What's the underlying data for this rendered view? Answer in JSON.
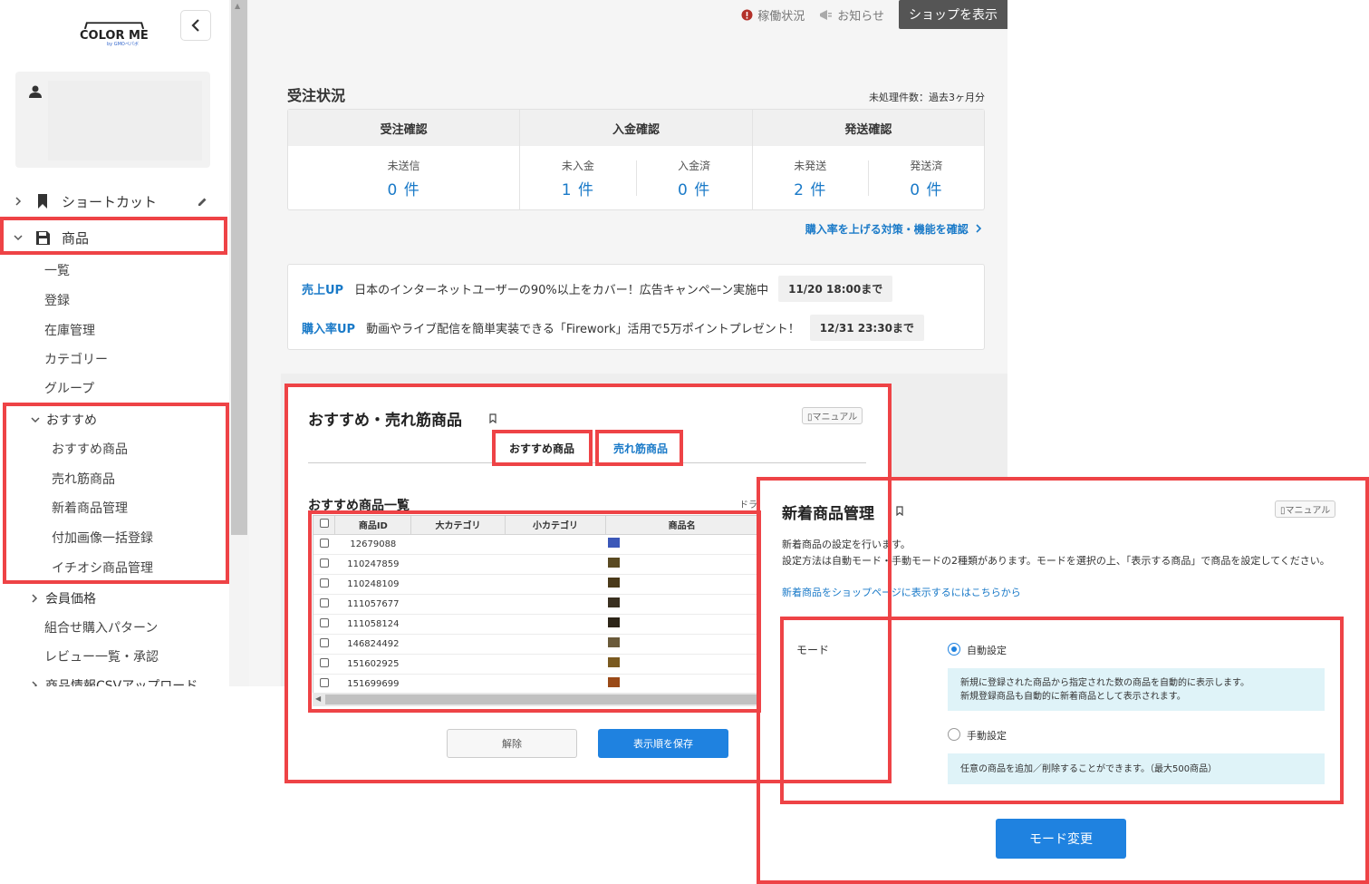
{
  "sidebar": {
    "logo_text": "COLOR ME",
    "logo_sub": "by GMOペパボ",
    "shortcut_label": "ショートカット",
    "products_label": "商品",
    "product_items": [
      "一覧",
      "登録",
      "在庫管理",
      "カテゴリー",
      "グループ"
    ],
    "recommend_label": "おすすめ",
    "recommend_items": [
      "おすすめ商品",
      "売れ筋商品",
      "新着商品管理",
      "付加画像一括登録",
      "イチオシ商品管理"
    ],
    "member_price_label": "会員価格",
    "more_items": [
      "組合せ購入パターン",
      "レビュー一覧・承認",
      "商品情報CSVアップロード"
    ]
  },
  "topbar": {
    "status_label": "稼働状況",
    "news_label": "お知らせ",
    "shop_button": "ショップを表示"
  },
  "orders": {
    "title": "受注状況",
    "note": "未処理件数：過去3ヶ月分",
    "headers": [
      "受注確認",
      "入金確認",
      "発送確認"
    ],
    "unsent_label": "未送信",
    "unsent_value": "0 件",
    "unpaid_label": "未入金",
    "unpaid_value": "1 件",
    "paid_label": "入金済",
    "paid_value": "0 件",
    "unshipped_label": "未発送",
    "unshipped_value": "2 件",
    "shipped_label": "発送済",
    "shipped_value": "0 件",
    "conversion_link": "購入率を上げる対策・機能を確認"
  },
  "promos": [
    {
      "tag": "売上UP",
      "text": "日本のインターネットユーザーの90%以上をカバー！広告キャンペーン実施中",
      "deadline": "11/20 18:00まで"
    },
    {
      "tag": "購入率UP",
      "text": "動画やライブ配信を簡単実装できる「Firework」活用で5万ポイントプレゼント！",
      "deadline": "12/31 23:30まで"
    }
  ],
  "recommend_panel": {
    "title": "おすすめ・売れ筋商品",
    "manual": "マニュアル",
    "tab_recommend": "おすすめ商品",
    "tab_bestseller": "売れ筋商品",
    "list_title": "おすすめ商品一覧",
    "drag_hint": "ドラ",
    "columns": [
      "商品ID",
      "大カテゴリ",
      "小カテゴリ",
      "商品名"
    ],
    "rows": [
      "12679088",
      "110247859",
      "110248109",
      "111057677",
      "111058124",
      "146824492",
      "151602925",
      "151699699"
    ],
    "release_button": "解除",
    "save_button": "表示順を保存"
  },
  "new_panel": {
    "title": "新着商品管理",
    "manual": "マニュアル",
    "desc1": "新着商品の設定を行います。",
    "desc2": "設定方法は自動モード・手動モードの2種類があります。モードを選択の上、「表示する商品」で商品を設定してください。",
    "link": "新着商品をショップページに表示するにはこちらから",
    "mode_label": "モード",
    "auto_label": "自動設定",
    "auto_info1": "新規に登録された商品から指定された数の商品を自動的に表示します。",
    "auto_info2": "新規登録商品も自動的に新着商品として表示されます。",
    "manual_label": "手動設定",
    "manual_info": "任意の商品を追加／削除することができます。（最大500商品）",
    "mode_change_button": "モード変更"
  },
  "colors": {
    "highlight": "#ee4346",
    "accent_blue": "#1f82e0",
    "link_blue": "#1a7ac8"
  }
}
